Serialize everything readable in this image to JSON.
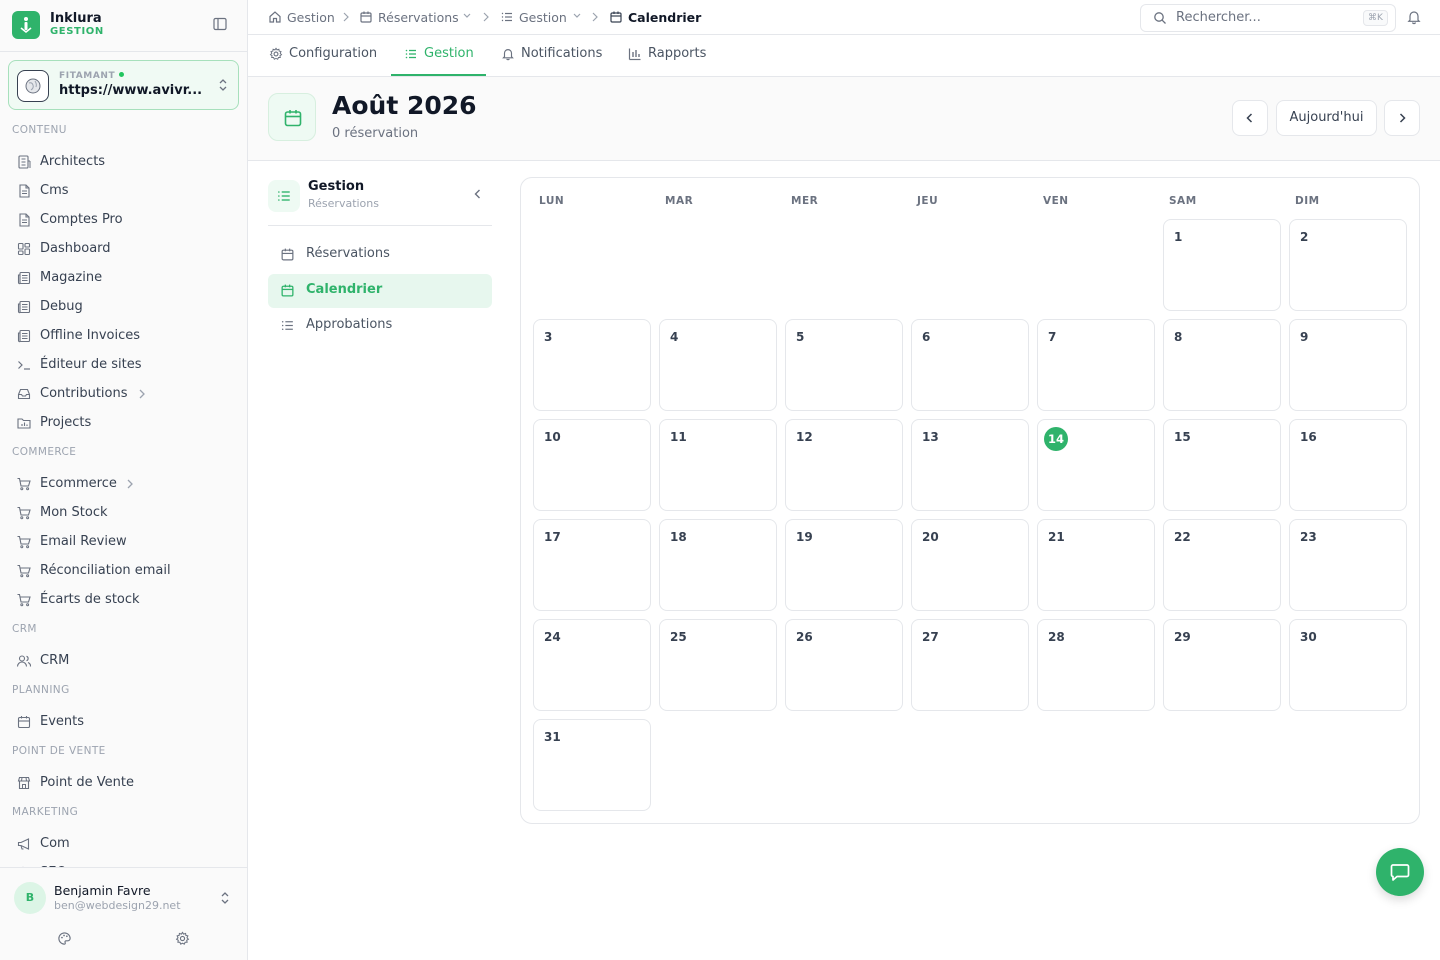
{
  "brand": {
    "name": "Inklura",
    "subtitle": "GESTION"
  },
  "site": {
    "label": "FITAMANT",
    "url": "https://www.avivr..."
  },
  "sidebar": {
    "sections": [
      {
        "title": "CONTENU",
        "items": [
          {
            "label": "Architects",
            "icon": "building-icon"
          },
          {
            "label": "Cms",
            "icon": "file-icon"
          },
          {
            "label": "Comptes Pro",
            "icon": "file-icon"
          },
          {
            "label": "Dashboard",
            "icon": "grid-icon"
          },
          {
            "label": "Magazine",
            "icon": "newspaper-icon"
          },
          {
            "label": "Debug",
            "icon": "newspaper-icon"
          },
          {
            "label": "Offline Invoices",
            "icon": "newspaper-icon"
          },
          {
            "label": "Éditeur de sites",
            "icon": "terminal-icon"
          },
          {
            "label": "Contributions",
            "icon": "inbox-icon"
          },
          {
            "label": "Projects",
            "icon": "folder-chart-icon"
          }
        ]
      },
      {
        "title": "COMMERCE",
        "items": [
          {
            "label": "Ecommerce",
            "icon": "cart-icon"
          },
          {
            "label": "Mon Stock",
            "icon": "cart-icon"
          },
          {
            "label": "Email Review",
            "icon": "cart-icon"
          },
          {
            "label": "Réconciliation email",
            "icon": "cart-icon"
          },
          {
            "label": "Écarts de stock",
            "icon": "cart-icon"
          }
        ]
      },
      {
        "title": "CRM",
        "items": [
          {
            "label": "CRM",
            "icon": "users-icon"
          }
        ]
      },
      {
        "title": "PLANNING",
        "items": [
          {
            "label": "Events",
            "icon": "calendar-icon"
          }
        ]
      },
      {
        "title": "POINT DE VENTE",
        "items": [
          {
            "label": "Point de Vente",
            "icon": "store-icon"
          }
        ]
      },
      {
        "title": "MARKETING",
        "items": [
          {
            "label": "Com",
            "icon": "megaphone-icon"
          },
          {
            "label": "SEO",
            "icon": "search-icon"
          }
        ]
      }
    ]
  },
  "user": {
    "initial": "B",
    "name": "Benjamin Favre",
    "email": "ben@webdesign29.net"
  },
  "breadcrumb": {
    "items": [
      {
        "label": "Gestion",
        "icon": "home-icon"
      },
      {
        "label": "Réservations",
        "icon": "calendar-icon",
        "dropdown": true
      },
      {
        "label": "Gestion",
        "icon": "list-icon",
        "dropdown": true
      },
      {
        "label": "Calendrier",
        "icon": "calendar-icon"
      }
    ]
  },
  "search": {
    "placeholder": "Rechercher...",
    "shortcut": "⌘K"
  },
  "tabs": [
    {
      "label": "Configuration",
      "icon": "gear-icon"
    },
    {
      "label": "Gestion",
      "icon": "list-icon",
      "active": true
    },
    {
      "label": "Notifications",
      "icon": "bell-icon"
    },
    {
      "label": "Rapports",
      "icon": "bar-chart-icon"
    }
  ],
  "header": {
    "title": "Août 2026",
    "count": "0 réservation",
    "today_label": "Aujourd'hui"
  },
  "subnav": {
    "title": "Gestion",
    "subtitle": "Réservations",
    "items": [
      {
        "label": "Réservations",
        "icon": "calendar-icon"
      },
      {
        "label": "Calendrier",
        "icon": "calendar-icon",
        "active": true
      },
      {
        "label": "Approbations",
        "icon": "list-icon"
      }
    ]
  },
  "calendar": {
    "weekdays": [
      "LUN",
      "MAR",
      "MER",
      "JEU",
      "VEN",
      "SAM",
      "DIM"
    ],
    "first_weekday_index": 5,
    "days_in_month": 31,
    "today": 14
  },
  "colors": {
    "accent": "#2fb36b",
    "accent_light": "#e7f7ee",
    "border": "#e5e7eb",
    "text": "#1f2937",
    "muted": "#6b7280"
  }
}
